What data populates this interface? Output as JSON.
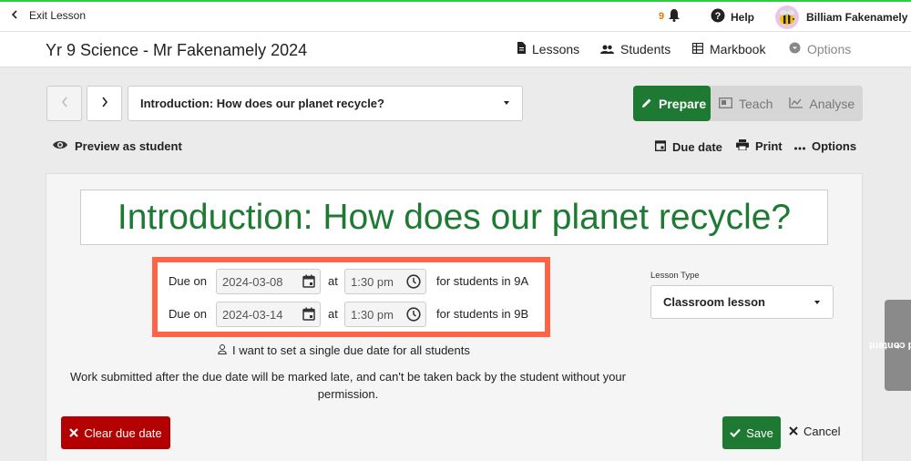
{
  "topbar": {
    "exit_label": "Exit Lesson",
    "notification_count": "9",
    "help_label": "Help",
    "user_name": "Billiam Fakenamely"
  },
  "classbar": {
    "title": "Yr 9 Science - Mr Fakenamely 2024",
    "nav": {
      "lessons": "Lessons",
      "students": "Students",
      "markbook": "Markbook",
      "options": "Options"
    }
  },
  "lesson_select": {
    "value": "Introduction: How does our planet recycle?"
  },
  "modes": {
    "prepare": "Prepare",
    "teach": "Teach",
    "analyse": "Analyse"
  },
  "actions": {
    "preview": "Preview as student",
    "due_date": "Due date",
    "print": "Print",
    "options": "Options"
  },
  "lesson_title": "Introduction: How does our planet recycle?",
  "due_rows": [
    {
      "due_on": "Due on",
      "date": "2024-03-08",
      "at": "at",
      "time": "1:30 pm",
      "students": "for students in 9A"
    },
    {
      "due_on": "Due on",
      "date": "2024-03-14",
      "at": "at",
      "time": "1:30 pm",
      "students": "for students in 9B"
    }
  ],
  "single_due_label": "I want to set a single due date for all students",
  "late_note": "Work submitted after the due date will be marked late, and can't be taken back by the student without your permission.",
  "lesson_type": {
    "label": "Lesson Type",
    "value": "Classroom lesson"
  },
  "add_content": "Add content",
  "buttons": {
    "clear": "Clear due date",
    "save": "Save",
    "cancel": "Cancel"
  },
  "colors": {
    "accent_green": "#1e7a32",
    "danger_red": "#b30000",
    "highlight_orange": "#ff6348",
    "notif_orange": "#e07b00"
  }
}
